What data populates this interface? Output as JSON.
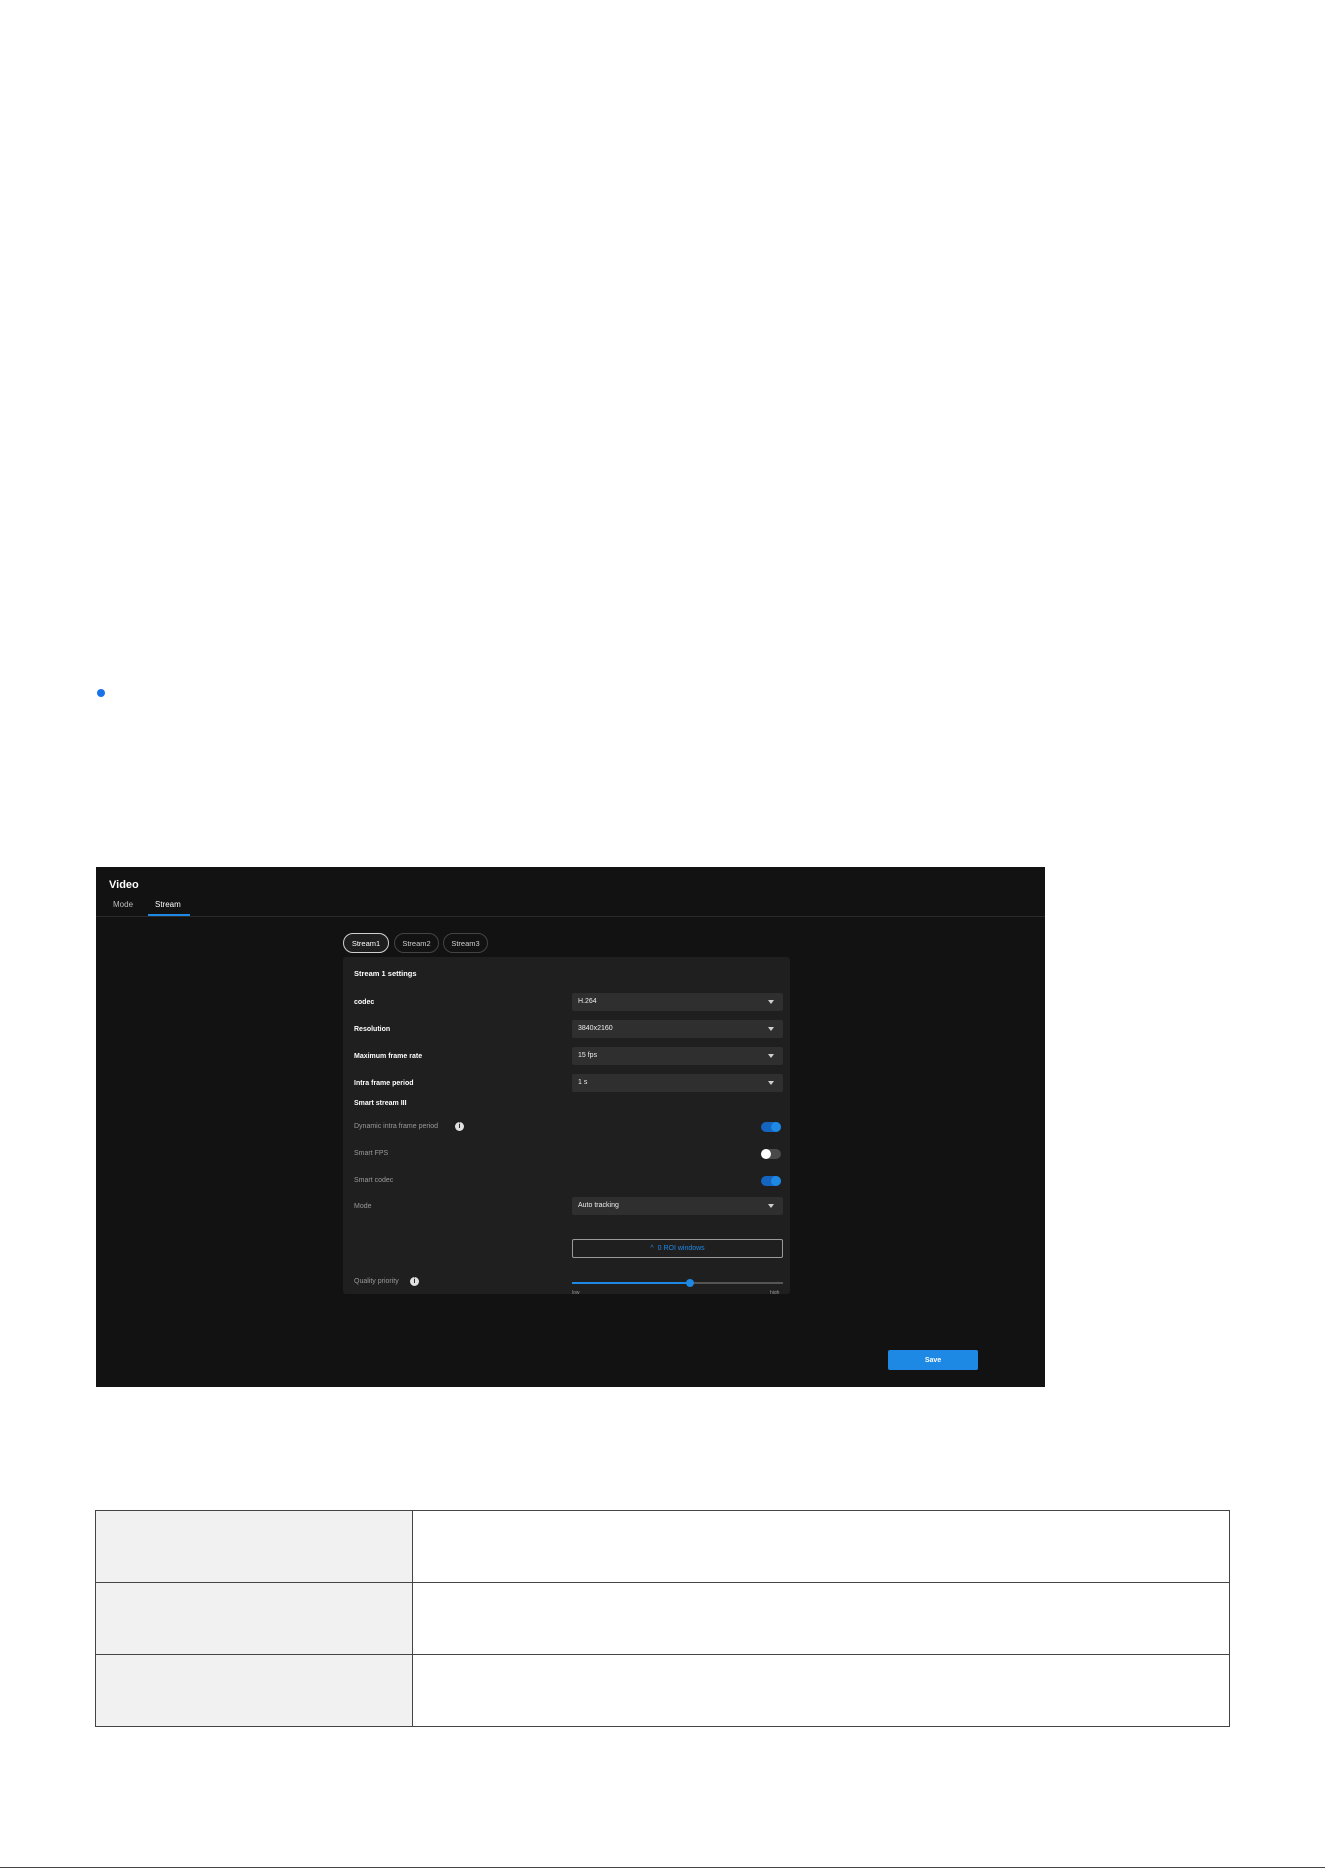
{
  "colors": {
    "accent": "#1e88e5",
    "bullet": "#1a73e8",
    "app_bg": "#121212",
    "panel_bg": "#1f1f1f"
  },
  "app": {
    "title": "Video",
    "tabs": [
      {
        "label": "Mode"
      },
      {
        "label": "Stream",
        "active": true
      }
    ],
    "stream_tabs": [
      {
        "label": "Stream1",
        "active": true
      },
      {
        "label": "Stream2"
      },
      {
        "label": "Stream3"
      }
    ],
    "panel": {
      "title": "Stream 1 settings",
      "codec": {
        "label": "codec",
        "value": "H.264"
      },
      "resolution": {
        "label": "Resolution",
        "value": "3840x2160"
      },
      "max_frame_rate": {
        "label": "Maximum frame rate",
        "value": "15 fps"
      },
      "intra_frame_period": {
        "label": "Intra frame period",
        "value": "1 s"
      },
      "smart_stream": {
        "label": "Smart stream III"
      },
      "dynamic_intra": {
        "label": "Dynamic intra frame period",
        "on": true,
        "icon": "info-icon"
      },
      "smart_fps": {
        "label": "Smart FPS",
        "on": false
      },
      "smart_codec": {
        "label": "Smart codec",
        "on": true
      },
      "mode": {
        "label": "Mode",
        "value": "Auto tracking"
      },
      "roi_button": {
        "label": "0 ROI windows",
        "icon": "chevron-up-icon"
      },
      "quality_priority": {
        "label": "Quality priority",
        "level_percent": 56,
        "min_label": "low",
        "max_label": "high",
        "icon": "info-icon"
      }
    },
    "save_label": "Save"
  },
  "table": {
    "rows": [
      {
        "key": "",
        "value": ""
      },
      {
        "key": "",
        "value": ""
      },
      {
        "key": "",
        "value": ""
      }
    ]
  }
}
